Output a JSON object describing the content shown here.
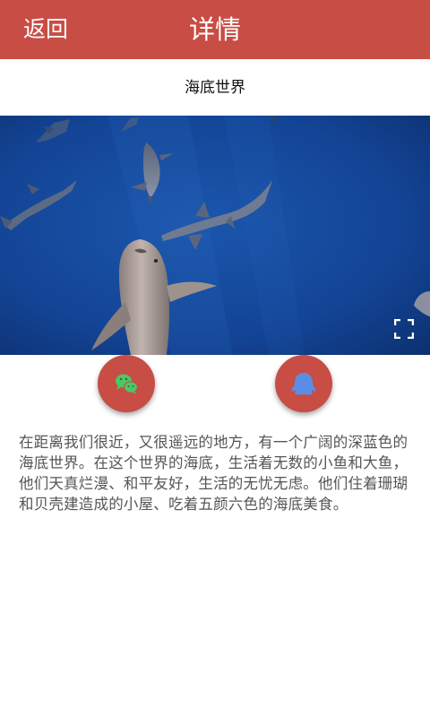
{
  "header": {
    "back_label": "返回",
    "title": "详情"
  },
  "content": {
    "title": "海底世界",
    "description": "在距离我们很近，又很遥远的地方，有一个广阔的深蓝色的海底世界。在这个世界的海底，生活着无数的小鱼和大鱼，他们天真烂漫、和平友好，生活的无忧无虑。他们住着珊瑚和贝壳建造成的小屋、吃着五颜六色的海底美食。"
  },
  "video": {
    "subject": "sharks-underwater",
    "fullscreen_icon": "fullscreen-icon"
  },
  "share": {
    "wechat_icon": "wechat-icon",
    "qq_icon": "qq-icon"
  },
  "colors": {
    "header": "#c84d44",
    "share_button": "#c84d44",
    "wechat_icon": "#4cc764",
    "qq_icon": "#5a8de6",
    "water": "#123f8a"
  }
}
